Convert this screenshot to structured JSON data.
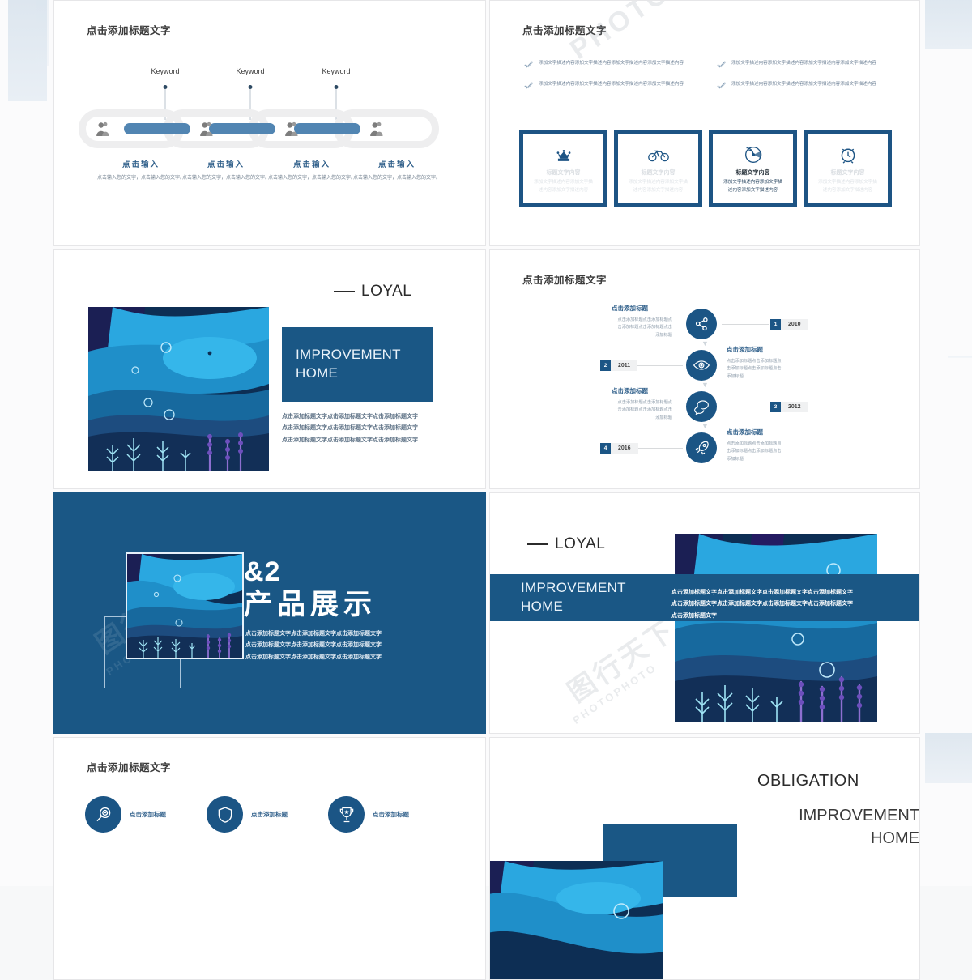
{
  "colors": {
    "brand_blue": "#1a5785",
    "accent_blue": "#5185b2",
    "title_blue": "#2f5f8a",
    "page_bg": "#fbfbfc",
    "edge_block": "#cfdce8"
  },
  "watermarks": {
    "photo_cn": "PHOTO.CN",
    "photo": "PHOTOPHOTO",
    "tuxing": "图行天下"
  },
  "slides": {
    "row0_left": {
      "type": "dark-cover-partial",
      "body_text": "点击添加标题文字点击添加标题文字点击添加标题文字"
    },
    "row0_right": {
      "type": "dark-cover-partial"
    },
    "chain": {
      "title": "点击添加标题文字",
      "keywords": [
        "Keyword",
        "Keyword",
        "Keyword"
      ],
      "items": [
        {
          "heading": "点击输入",
          "desc": "点击输入您的文字，点击输入您的文字。"
        },
        {
          "heading": "点击输入",
          "desc": "点击输入您的文字，点击输入您的文字。"
        },
        {
          "heading": "点击输入",
          "desc": "点击输入您的文字，点击输入您的文字。"
        },
        {
          "heading": "点击输入",
          "desc": "点击输入您的文字，点击输入您的文字。"
        }
      ]
    },
    "checks": {
      "title": "点击添加标题文字",
      "bullets": [
        "添加文字描述内容添加文字描述内容添加文字描述内容添加文字描述内容",
        "添加文字描述内容添加文字描述内容添加文字描述内容添加文字描述内容",
        "添加文字描述内容添加文字描述内容添加文字描述内容添加文字描述内容",
        "添加文字描述内容添加文字描述内容添加文字描述内容添加文字描述内容"
      ],
      "boxes": [
        {
          "icon": "crown-icon",
          "title": "标题文字内容",
          "desc": "添加文字描述内容添加文字描述内容添加文字描述内容",
          "active": false
        },
        {
          "icon": "bicycle-icon",
          "title": "标题文字内容",
          "desc": "添加文字描述内容添加文字描述内容添加文字描述内容",
          "active": false
        },
        {
          "icon": "vinyl-icon",
          "title": "标题文字内容",
          "desc": "添加文字描述内容添加文字描述内容添加文字描述内容",
          "active": true
        },
        {
          "icon": "alarm-clock-icon",
          "title": "标题文字内容",
          "desc": "添加文字描述内容添加文字描述内容添加文字描述内容",
          "active": false
        }
      ]
    },
    "loyal_left": {
      "eyebrow": "LOYAL",
      "headline_line1": "IMPROVEMENT",
      "headline_line2": "HOME",
      "body": "点击添加标题文字点击添加标题文字点击添加标题文字\n点击添加标题文字点击添加标题文字点击添加标题文字\n点击添加标题文字点击添加标题文字点击添加标题文字",
      "body_lines": [
        "点击添加标题文字点击添加标题文字点击添加标题文字",
        "点击添加标题文字点击添加标题文字点击添加标题文字",
        "点击添加标题文字点击添加标题文字点击添加标题文字"
      ]
    },
    "timeline": {
      "title": "点击添加标题文字",
      "nodes": [
        {
          "icon": "network-share-icon",
          "title": "点击添加标题",
          "desc": "点击添加标题点击添加标题点击添加标题点击添加标题点击添加标题",
          "index": "1",
          "year": "2010",
          "side": "right"
        },
        {
          "icon": "eye-icon",
          "title": "点击添加标题",
          "desc": "点击添加标题点击添加标题点击添加标题点击添加标题点击添加标题",
          "index": "2",
          "year": "2011",
          "side": "left"
        },
        {
          "icon": "chat-bubbles-icon",
          "title": "点击添加标题",
          "desc": "点击添加标题点击添加标题点击添加标题点击添加标题点击添加标题",
          "index": "3",
          "year": "2012",
          "side": "right"
        },
        {
          "icon": "rocket-icon",
          "title": "点击添加标题",
          "desc": "点击添加标题点击添加标题点击添加标题点击添加标题点击添加标题",
          "index": "4",
          "year": "2016",
          "side": "left"
        }
      ]
    },
    "section_cover": {
      "number": "&2",
      "title": "产品展示",
      "body_lines": [
        "点击添加标题文字点击添加标题文字点击添加标题文字",
        "点击添加标题文字点击添加标题文字点击添加标题文字",
        "点击添加标题文字点击添加标题文字点击添加标题文字"
      ]
    },
    "loyal_right": {
      "eyebrow": "LOYAL",
      "headline_line1": "IMPROVEMENT",
      "headline_line2": "HOME",
      "body_lines": [
        "点击添加标题文字点击添加标题文字点击添加标题文字点击添加标题文字",
        "点击添加标题文字点击添加标题文字点击添加标题文字点击添加标题文字",
        "点击添加标题文字"
      ]
    },
    "row4_left": {
      "title": "点击添加标题文字",
      "items": [
        {
          "icon": "magnifier-minus-icon",
          "label": "点击添加标题"
        },
        {
          "icon": "shield-icon",
          "label": "点击添加标题"
        },
        {
          "icon": "trophy-icon",
          "label": "点击添加标题"
        }
      ]
    },
    "row4_right": {
      "eyebrow": "OBLIGATION",
      "headline_line1": "IMPROVEMENT",
      "headline_line2": "HOME"
    }
  }
}
